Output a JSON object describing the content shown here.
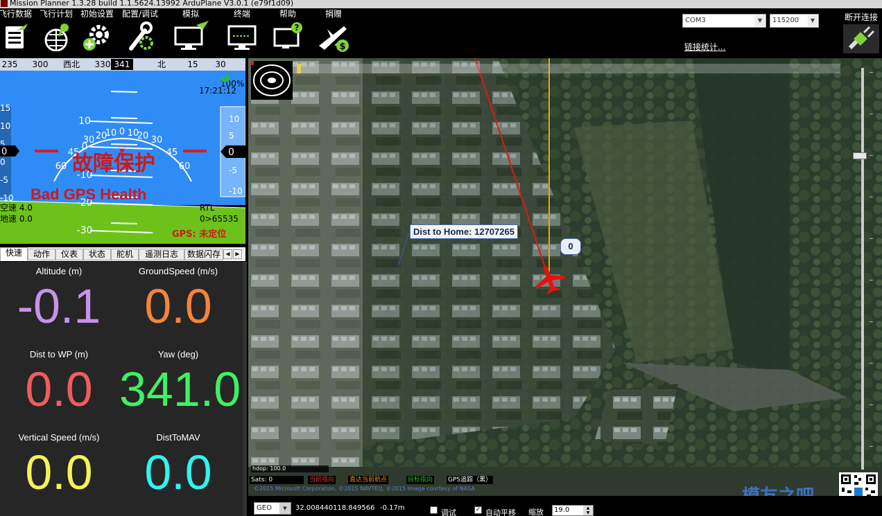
{
  "window": {
    "title": "Mission Planner 1.3.28 build 1.1.5624.13992 ArduPlane V3.0.1 (e79f1d09)"
  },
  "toolbar": {
    "items": [
      {
        "label": "飞行数据",
        "icon": "flight-data-icon"
      },
      {
        "label": "飞行计划",
        "icon": "flight-plan-icon"
      },
      {
        "label": "初始设置",
        "icon": "initial-setup-icon"
      },
      {
        "label": "配置/调试",
        "icon": "config-tuning-icon"
      },
      {
        "label": "模拟",
        "icon": "simulation-icon"
      },
      {
        "label": "终端",
        "icon": "terminal-icon"
      },
      {
        "label": "帮助",
        "icon": "help-icon"
      },
      {
        "label": "捐赠",
        "icon": "donate-icon"
      }
    ],
    "port": "COM3",
    "baud": "115200",
    "link_stats": "链接统计...",
    "disconnect": "断开连接"
  },
  "hud": {
    "heading_ticks": [
      "235",
      "300",
      "西北",
      "330",
      "345",
      "北",
      "15",
      "30"
    ],
    "heading_value": "341",
    "roll_scale": [
      "60",
      "45",
      "30",
      "20",
      "10",
      "0",
      "10",
      "20",
      "30",
      "45",
      "60"
    ],
    "pitch_scale": [
      "10",
      "0",
      "-10",
      "-20",
      "-30"
    ],
    "time": "17:21:12",
    "battery_percent": "100%",
    "speed_tape": [
      "15",
      "10",
      "5",
      "0",
      "-5",
      "-10"
    ],
    "speed_box": "0",
    "alt_tape": [
      "10",
      "5",
      "0",
      "-5",
      "-10"
    ],
    "alt_box": "0",
    "failsafe_text": "故障保护",
    "gps_health_text": "Bad GPS Health",
    "airspeed_label": "空速 4.0",
    "groundspeed_label": "地速 0.0",
    "mode": "RTL",
    "wp_info": "0>65535",
    "gps_status": "GPS: 未定位"
  },
  "tabs": [
    "快速",
    "动作",
    "仪表",
    "状态",
    "舵机",
    "遥测日志",
    "数据闪存"
  ],
  "quick": [
    {
      "label": "Altitude (m)",
      "value": "-0.1",
      "color": "#c792ea"
    },
    {
      "label": "GroundSpeed (m/s)",
      "value": "0.0",
      "color": "#f5843a"
    },
    {
      "label": "Dist to WP (m)",
      "value": "0.0",
      "color": "#f25c5c"
    },
    {
      "label": "Yaw (deg)",
      "value": "341.0",
      "color": "#3ff065"
    },
    {
      "label": "Vertical Speed (m/s)",
      "value": "0.0",
      "color": "#f3f35a"
    },
    {
      "label": "DistToMAV",
      "value": "0.0",
      "color": "#2ef5f0"
    }
  ],
  "map": {
    "dist_label": "Dist to Home: 12707265",
    "waypoint_label": "0",
    "hdop": "hdop: 100.0",
    "sats": "Sats: 0",
    "legend": [
      {
        "text": "当前指向",
        "color": "#e03030"
      },
      {
        "text": "直达当前航点",
        "color": "#f08a1e"
      },
      {
        "text": "目标指向",
        "color": "#27c227"
      },
      {
        "text": "GPS追踪（黑）",
        "color": "#ffffff"
      }
    ],
    "copyright": "©2015 Microsoft Corporation, ©2015 NAVTEQ, ©2015 Image courtesy of NASA",
    "coord_format": "GEO",
    "lat": "32.008440",
    "lon": "118.849566",
    "alt": "-0.17m",
    "debug_label": "调试",
    "autopan_label": "自动平移",
    "zoom_label": "缩放",
    "zoom_value": "19.0",
    "watermark": "模友之吧",
    "colors": {
      "heading_line": "#e01818",
      "target_line": "#f0a020",
      "plane": "#e81010"
    }
  }
}
